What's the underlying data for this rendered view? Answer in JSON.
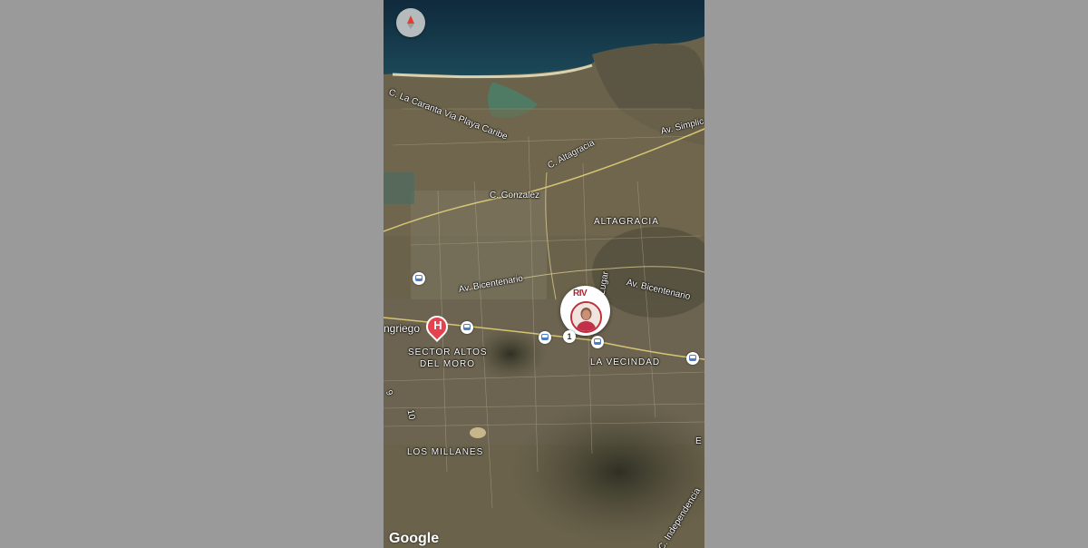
{
  "map": {
    "attribution": "Google",
    "compass": {
      "icon": "compass-icon"
    },
    "road_labels": [
      "C. La Caranta Via Playa Caribe",
      "Av. Simplic",
      "C. Altagracia",
      "C. Gonzalez",
      "Av. Bicentenario",
      "Av. Bicentenario",
      "Lugar",
      "C. Independencia"
    ],
    "area_labels": {
      "altagracia": "ALTAGRACIA",
      "sector_altos_line1": "SECTOR ALTOS",
      "sector_altos_line2": "DEL MORO",
      "la_vecindad": "LA VECINDAD",
      "los_millanes": "LOS MILLANES",
      "edge_e": "E",
      "edge_9": "9",
      "edge_10": "10",
      "ngriego": "ngriego"
    },
    "markers": {
      "hospital": {
        "letter": "H",
        "color": "#e5414f"
      },
      "profile": {
        "brand": "RIV",
        "brand_color": "#b0202c"
      },
      "cluster_count": "1"
    },
    "transit_icons": [
      "bus-stop-icon",
      "bus-stop-icon",
      "bus-stop-icon",
      "bus-stop-icon",
      "bus-stop-icon"
    ]
  }
}
